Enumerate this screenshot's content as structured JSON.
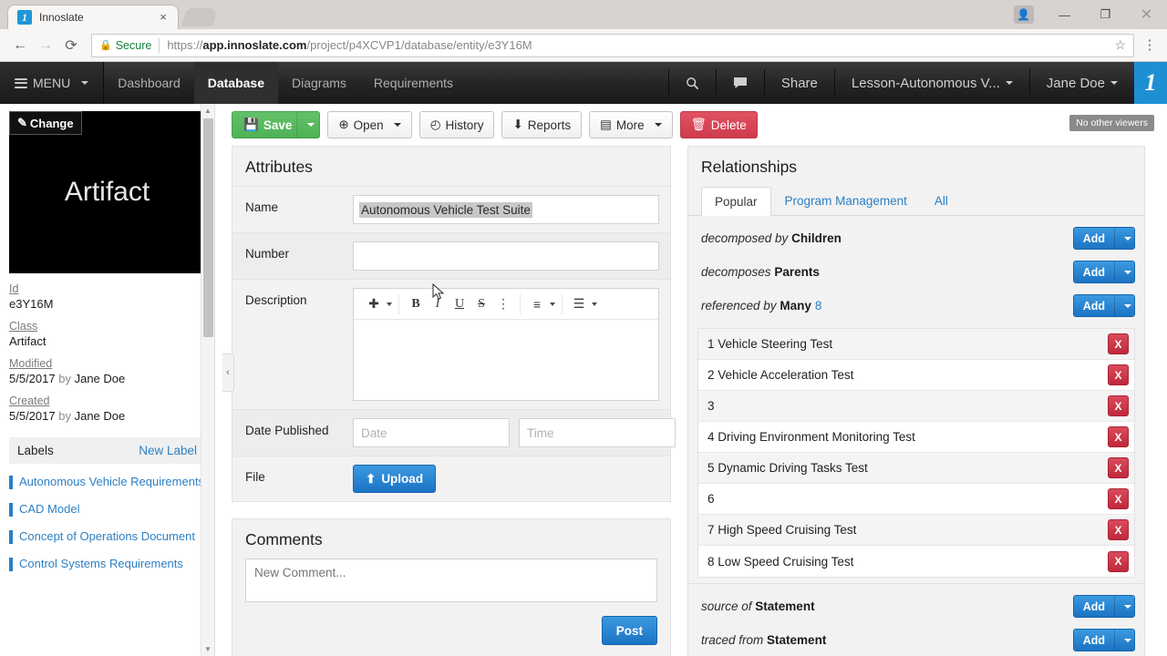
{
  "browser": {
    "tab": {
      "title": "Innoslate",
      "favicon": "innoslate-logo-icon",
      "close": "×"
    },
    "window_controls": {
      "avatar": "👤",
      "minimize": "—",
      "maximize": "❐",
      "close": "✕"
    },
    "nav": {
      "back": "←",
      "forward": "→",
      "reload": "⟳"
    },
    "security_label": "Secure",
    "url_prefix": "https://",
    "url_host": "app.innoslate.com",
    "url_path": "/project/p4XCVP1/database/entity/e3Y16M",
    "star": "☆",
    "overflow": "⋮"
  },
  "appnav": {
    "menu_label": "MENU",
    "items": [
      {
        "label": "Dashboard",
        "active": false
      },
      {
        "label": "Database",
        "active": true
      },
      {
        "label": "Diagrams",
        "active": false
      },
      {
        "label": "Requirements",
        "active": false
      }
    ],
    "search_icon": "⌕",
    "chat_icon": "▬",
    "share_label": "Share",
    "project_label": "Lesson-Autonomous V...",
    "user_label": "Jane Doe",
    "brand": "1"
  },
  "sidebar": {
    "change_label": "Change",
    "change_icon": "✎",
    "thumbnail_text": "Artifact",
    "meta": [
      {
        "key": "Id",
        "value": "e3Y16M",
        "by": ""
      },
      {
        "key": "Class",
        "value": "Artifact",
        "by": ""
      },
      {
        "key": "Modified",
        "value": "5/5/2017",
        "by": "Jane Doe"
      },
      {
        "key": "Created",
        "value": "5/5/2017",
        "by": "Jane Doe"
      }
    ],
    "by_word": "by",
    "labels_title": "Labels",
    "new_label": "New Label",
    "labels": [
      "Autonomous Vehicle Requirements",
      "CAD Model",
      "Concept of Operations Document",
      "Control Systems Requirements"
    ],
    "collapse_icon": "‹",
    "scroll_up": "▲",
    "scroll_down": "▼"
  },
  "toolbar": {
    "save_label": "Save",
    "save_icon": "💾",
    "open_label": "Open",
    "open_icon": "⊕",
    "history_label": "History",
    "history_icon": "◴",
    "reports_label": "Reports",
    "reports_icon": "⬇",
    "more_label": "More",
    "more_icon": "▤",
    "delete_label": "Delete",
    "delete_icon": "🗑",
    "viewers_badge": "No other viewers"
  },
  "attributes": {
    "title": "Attributes",
    "name_label": "Name",
    "name_value": "Autonomous Vehicle Test Suite",
    "number_label": "Number",
    "number_value": "",
    "number_placeholder": "",
    "description_label": "Description",
    "description_value": "",
    "editor_tools": {
      "insert": "✚",
      "bold": "B",
      "italic": "I",
      "underline": "U",
      "strikethrough": "S",
      "more": "⋮",
      "align": "≡",
      "list": "☰"
    },
    "date_published_label": "Date Published",
    "date_placeholder": "Date",
    "time_placeholder": "Time",
    "date_value": "",
    "time_value": "",
    "file_label": "File",
    "upload_label": "Upload",
    "upload_icon": "⬆"
  },
  "comments": {
    "title": "Comments",
    "placeholder": "New Comment...",
    "value": "",
    "post_label": "Post"
  },
  "relationships": {
    "title": "Relationships",
    "tabs": [
      {
        "label": "Popular",
        "active": true
      },
      {
        "label": "Program Management",
        "active": false
      },
      {
        "label": "All",
        "active": false
      }
    ],
    "add_label": "Add",
    "remove_label": "X",
    "groups": [
      {
        "predicate": "decomposed by",
        "object": "Children",
        "count": ""
      },
      {
        "predicate": "decomposes",
        "object": "Parents",
        "count": ""
      },
      {
        "predicate": "referenced by",
        "object": "Many",
        "count": "8"
      }
    ],
    "items": [
      "1 Vehicle Steering Test",
      "2 Vehicle Acceleration Test",
      "3",
      "4 Driving Environment Monitoring Test",
      "5 Dynamic Driving Tasks Test",
      "6",
      "7 High Speed Cruising Test",
      "8 Low Speed Cruising Test"
    ],
    "groups_bottom": [
      {
        "predicate": "source of",
        "object": "Statement",
        "count": ""
      },
      {
        "predicate": "traced from",
        "object": "Statement",
        "count": ""
      }
    ]
  }
}
